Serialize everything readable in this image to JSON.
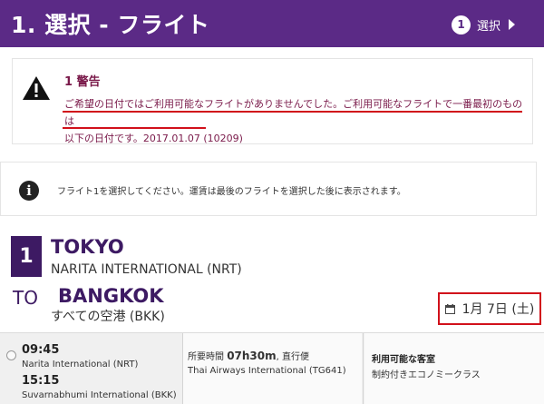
{
  "header": {
    "title": "1. 選択 - フライト",
    "step_number": "1",
    "step_label": "選択"
  },
  "warning": {
    "title": "1 警告",
    "line1": "ご希望の日付ではご利用可能なフライトがありませんでした。ご利用可能なフライトで一番最初のものは",
    "line2": "以下の日付です。2017.01.07 (10209)"
  },
  "info": {
    "text": "フライト1を選択してください。運賃は最後のフライトを選択した後に表示されます。"
  },
  "leg": {
    "number": "1",
    "origin_city": "TOKYO",
    "origin_airport": "NARITA INTERNATIONAL (NRT)",
    "to_label": "TO",
    "dest_city": "BANGKOK",
    "dest_airport": "すべての空港 (BKK)",
    "date": "1月 7日 (土)"
  },
  "flight": {
    "dep_time": "09:45",
    "dep_airport": "Narita International (NRT)",
    "arr_time": "15:15",
    "arr_airport": "Suvarnabhumi International (BKK)",
    "duration_label": "所要時間",
    "duration": "07h30m",
    "stops": ", 直行便",
    "airline": "Thai Airways International (TG641)",
    "cabin_title": "利用可能な客室",
    "cabin_value": "制約付きエコノミークラス"
  },
  "colors": {
    "brand_purple": "#5b2a86",
    "dark_purple": "#3d1a63",
    "warning_text": "#7a1a4a",
    "highlight_red": "#d1111b"
  }
}
